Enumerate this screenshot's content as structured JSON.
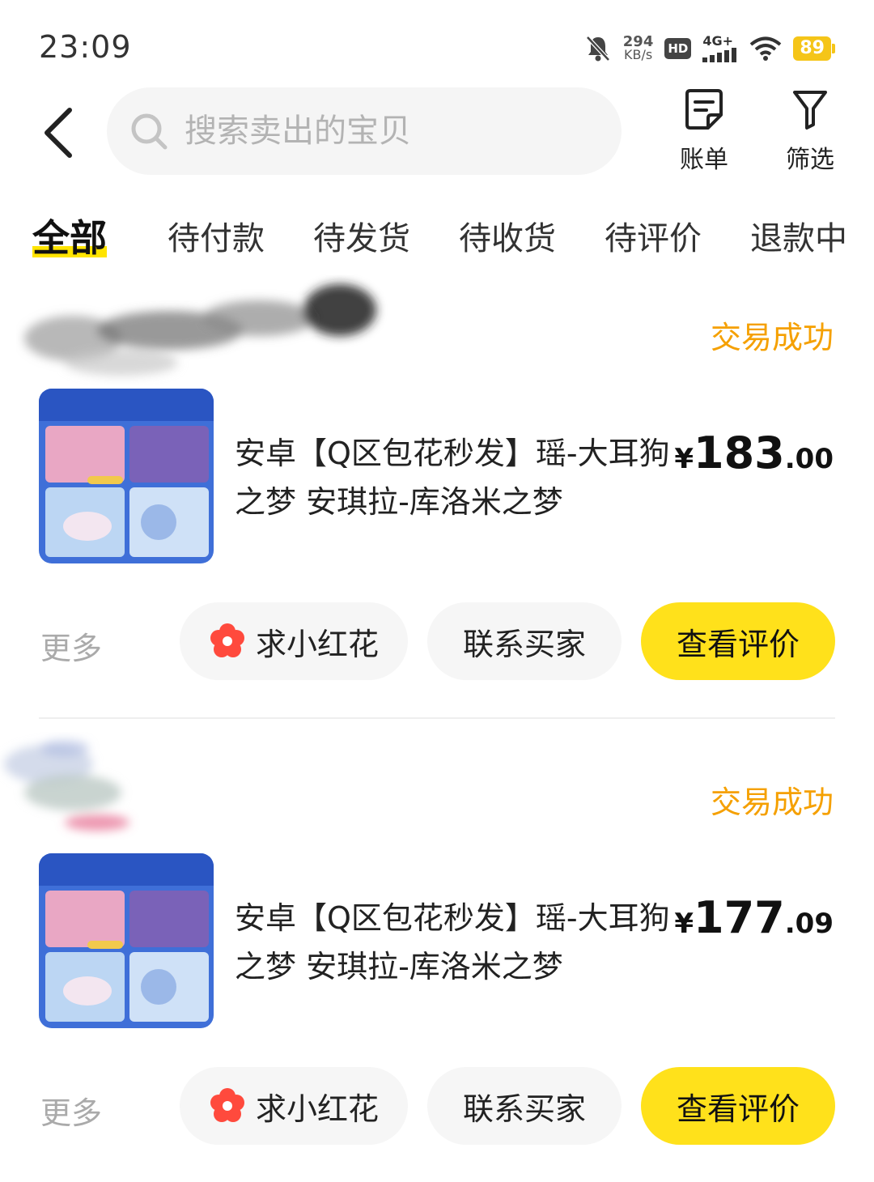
{
  "status_bar": {
    "time": "23:09",
    "net_speed": "294",
    "net_unit": "KB/s",
    "hd": "HD",
    "network": "4G+",
    "battery": "89",
    "icons": [
      "bell-off-icon",
      "signal-icon",
      "wifi-icon",
      "battery-icon"
    ]
  },
  "header": {
    "search_placeholder": "搜索卖出的宝贝",
    "bill_label": "账单",
    "filter_label": "筛选"
  },
  "tabs": [
    {
      "label": "全部",
      "active": true
    },
    {
      "label": "待付款",
      "active": false
    },
    {
      "label": "待发货",
      "active": false
    },
    {
      "label": "待收货",
      "active": false
    },
    {
      "label": "待评价",
      "active": false
    },
    {
      "label": "退款中",
      "active": false
    }
  ],
  "orders": [
    {
      "status": "交易成功",
      "title": "安卓【Q区包花秒发】瑶-大耳狗之梦 安琪拉-库洛米之梦",
      "price_currency": "¥",
      "price_int": "183",
      "price_dec": ".00",
      "more_label": "更多",
      "flower_button": "求小红花",
      "contact_button": "联系买家",
      "review_button": "查看评价"
    },
    {
      "status": "交易成功",
      "title": "安卓【Q区包花秒发】瑶-大耳狗之梦 安琪拉-库洛米之梦",
      "price_currency": "¥",
      "price_int": "177",
      "price_dec": ".09",
      "more_label": "更多",
      "flower_button": "求小红花",
      "contact_button": "联系买家",
      "review_button": "查看评价"
    }
  ],
  "colors": {
    "accent_yellow": "#ffe11b",
    "status_orange": "#f5a000",
    "flower_red": "#ff4a3d"
  }
}
